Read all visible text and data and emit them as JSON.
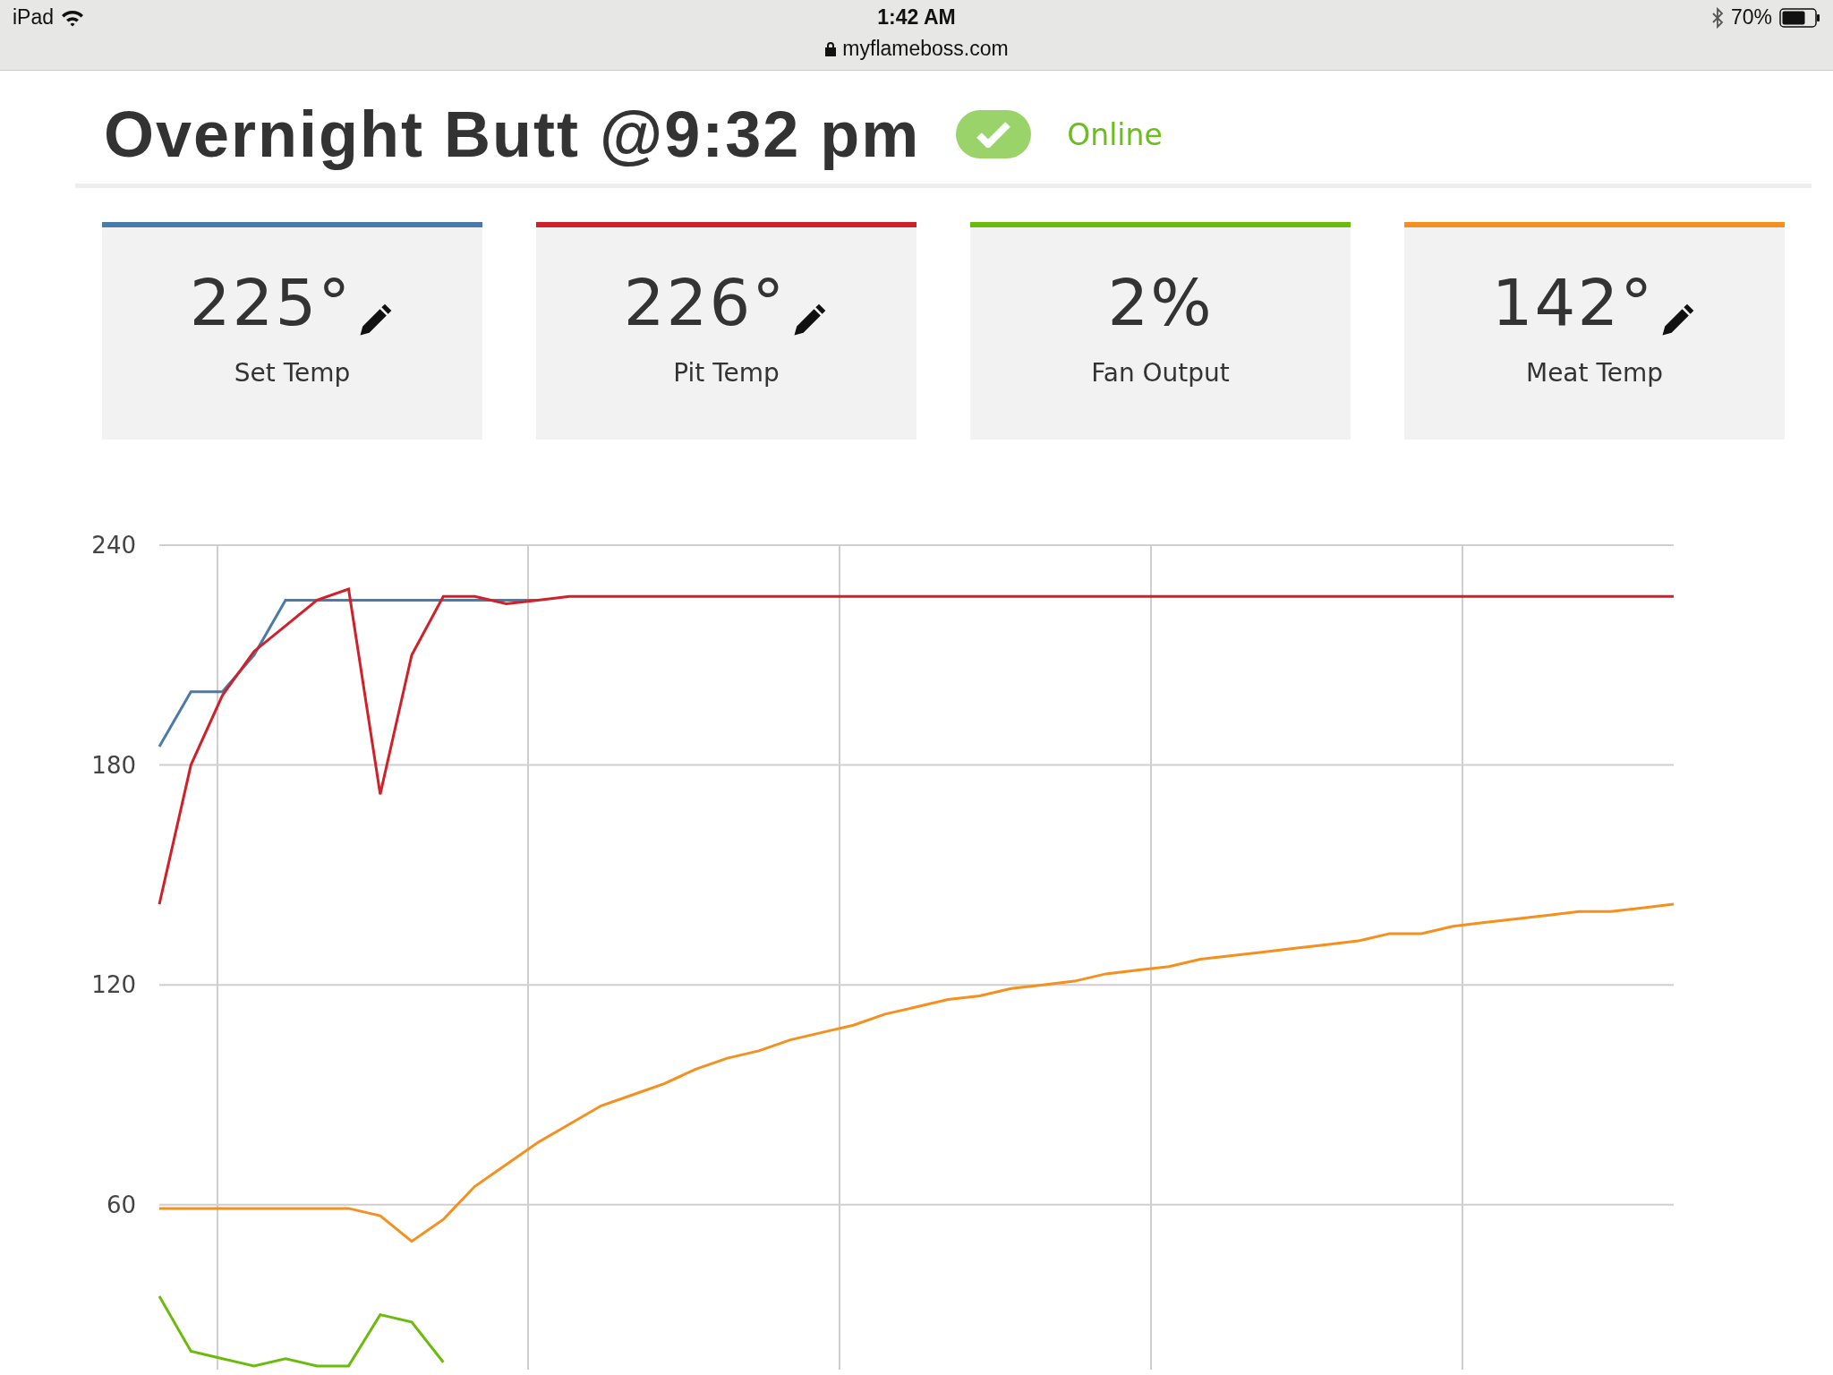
{
  "status_bar": {
    "device": "iPad",
    "time": "1:42 AM",
    "url": "myflameboss.com",
    "battery": "70%"
  },
  "header": {
    "title": "Overnight Butt @9:32 pm",
    "online": true,
    "status": "Online"
  },
  "cards": [
    {
      "value": "225°",
      "label": "Set Temp",
      "editable": true,
      "color": "#4a7aa8"
    },
    {
      "value": "226°",
      "label": "Pit Temp",
      "editable": true,
      "color": "#d0202a"
    },
    {
      "value": "2%",
      "label": "Fan Output",
      "editable": false,
      "color": "#6cbb0c"
    },
    {
      "value": "142°",
      "label": "Meat Temp",
      "editable": true,
      "color": "#f5901e"
    }
  ],
  "chart": {
    "chart_data": {
      "type": "line",
      "grid": true,
      "ylim": [
        15,
        240
      ],
      "yticks": [
        60,
        120,
        180,
        240
      ],
      "series": [
        {
          "color": "#4a7aa8",
          "values": [
            185,
            200,
            200,
            210,
            225,
            225,
            225,
            225,
            225,
            225,
            225,
            225,
            225,
            null,
            null,
            null,
            null,
            null,
            null,
            null,
            null,
            null,
            null,
            null,
            null,
            null,
            null,
            null,
            null,
            null,
            null,
            null,
            null,
            null,
            null,
            null,
            null,
            null,
            null,
            null,
            null,
            null,
            null,
            null,
            null,
            null,
            null,
            null,
            null
          ]
        },
        {
          "color": "#d0202a",
          "values": [
            142,
            180,
            199,
            211,
            218,
            225,
            228,
            172,
            210,
            226,
            226,
            224,
            225,
            226,
            226,
            226,
            226,
            226,
            226,
            226,
            226,
            226,
            226,
            226,
            226,
            226,
            226,
            226,
            226,
            226,
            226,
            226,
            226,
            226,
            226,
            226,
            226,
            226,
            226,
            226,
            226,
            226,
            226,
            226,
            226,
            226,
            226,
            226,
            226
          ]
        },
        {
          "color": "#f5901e",
          "values": [
            59,
            59,
            59,
            59,
            59,
            59,
            59,
            57,
            50,
            56,
            65,
            71,
            77,
            82,
            87,
            90,
            93,
            97,
            100,
            102,
            105,
            107,
            109,
            112,
            114,
            116,
            117,
            119,
            120,
            121,
            123,
            124,
            125,
            127,
            128,
            129,
            130,
            131,
            132,
            134,
            134,
            136,
            137,
            138,
            139,
            140,
            140,
            141,
            142
          ]
        },
        {
          "color": "#6cbb0c",
          "values": [
            35,
            20,
            18,
            16,
            18,
            16,
            16,
            30,
            28,
            17,
            null,
            null,
            null,
            null,
            null,
            null,
            null,
            null,
            null,
            null,
            null,
            null,
            null,
            null,
            null,
            null,
            null,
            null,
            null,
            null,
            null,
            null,
            null,
            null,
            null,
            null,
            null,
            null,
            null,
            null,
            null,
            null,
            null,
            null,
            null,
            null,
            null,
            null,
            null
          ]
        }
      ]
    }
  }
}
